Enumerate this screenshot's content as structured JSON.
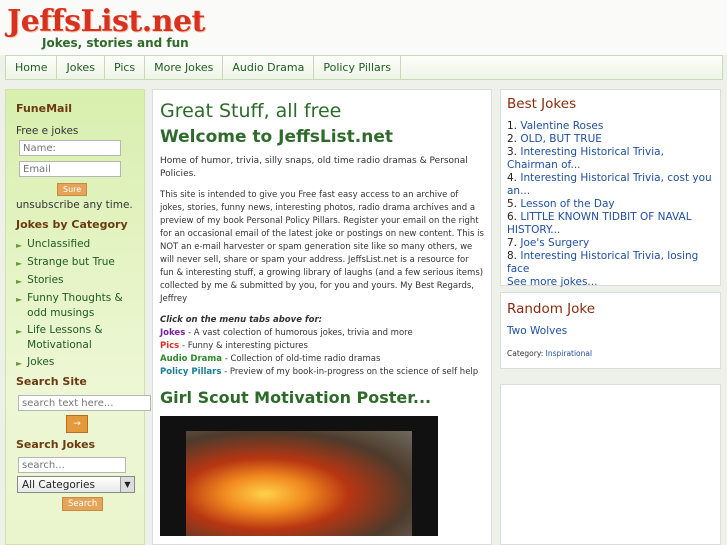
{
  "header": {
    "logo_title": "JeffsList.net",
    "logo_tagline": "Jokes, stories and fun"
  },
  "nav": {
    "items": [
      "Home",
      "Jokes",
      "Pics",
      "More Jokes",
      "Audio Drama",
      "Policy Pillars"
    ]
  },
  "sidebar": {
    "funemail_heading": "FuneMail",
    "free_jokes_label": "Free e jokes",
    "name_placeholder": "Name:",
    "email_placeholder": "Email",
    "sure_button": "Sure",
    "unsubscribe_text": "unsubscribe any time.",
    "categories_heading": "Jokes by Category",
    "categories": [
      "Unclassified",
      "Strange but True",
      "Stories",
      "Funny Thoughts & odd musings",
      "Life Lessons & Motivational",
      "Jokes"
    ],
    "search_site_heading": "Search Site",
    "search_site_placeholder": "search text here...",
    "search_site_go": "→",
    "search_jokes_heading": "Search Jokes",
    "search_jokes_placeholder": "search...",
    "category_select_value": "All Categories",
    "search_button": "Search"
  },
  "main": {
    "title": "Great Stuff, all free",
    "welcome": "Welcome to JeffsList.net",
    "intro": "Home of humor, trivia, silly snaps, old time radio dramas & Personal Policies.",
    "body": "This site is intended to give you Free fast easy access to an archive of jokes, stories, funny news, interesting photos, radio drama archives and a preview of my book Personal Policy Pillars. Register your email on the right for an occasional email of the latest joke or postings on new content. This is NOT an e-mail harvester or spam generation site like so many others, we will never sell, share or spam your address. JeffsList.net is a resource for fun & interesting stuff, a growing library of laughs (and a few serious items) collected by me & submitted by you, for you and yours. My Best Regards, Jeffrey",
    "menu_note": "Click on the menu tabs above for:",
    "tabs": [
      {
        "name": "Jokes",
        "desc": " - A vast colection of humorous jokes, trivia and more",
        "color": "#7a1fa0"
      },
      {
        "name": "Pics",
        "desc": " - Funny & interesting pictures",
        "color": "#d8311f"
      },
      {
        "name": "Audio Drama",
        "desc": " - Collection of old-time radio dramas",
        "color": "#2e8a2a"
      },
      {
        "name": "Policy Pillars",
        "desc": " - Preview of my book-in-progress on the science of self help",
        "color": "#1a7e9a"
      }
    ],
    "poster_title": "Girl Scout Motivation Poster..."
  },
  "best_jokes": {
    "heading": "Best Jokes",
    "items": [
      {
        "num": "1.",
        "title": "Valentine Roses"
      },
      {
        "num": "2.",
        "title": "OLD, BUT TRUE"
      },
      {
        "num": "3.",
        "title": "Interesting Historical Trivia, Chairman of..."
      },
      {
        "num": "4.",
        "title": "Interesting Historical Trivia, cost you an..."
      },
      {
        "num": "5.",
        "title": "Lesson of the Day"
      },
      {
        "num": "6.",
        "title": "LITTLE KNOWN TIDBIT OF NAVAL HISTORY..."
      },
      {
        "num": "7.",
        "title": "Joe's Surgery"
      },
      {
        "num": "8.",
        "title": "Interesting Historical Trivia, losing face"
      }
    ],
    "see_more": "See more jokes..."
  },
  "random_joke": {
    "heading": "Random Joke",
    "title": "Two Wolves",
    "category_label": "Category:",
    "category_value": "Inspirational"
  }
}
